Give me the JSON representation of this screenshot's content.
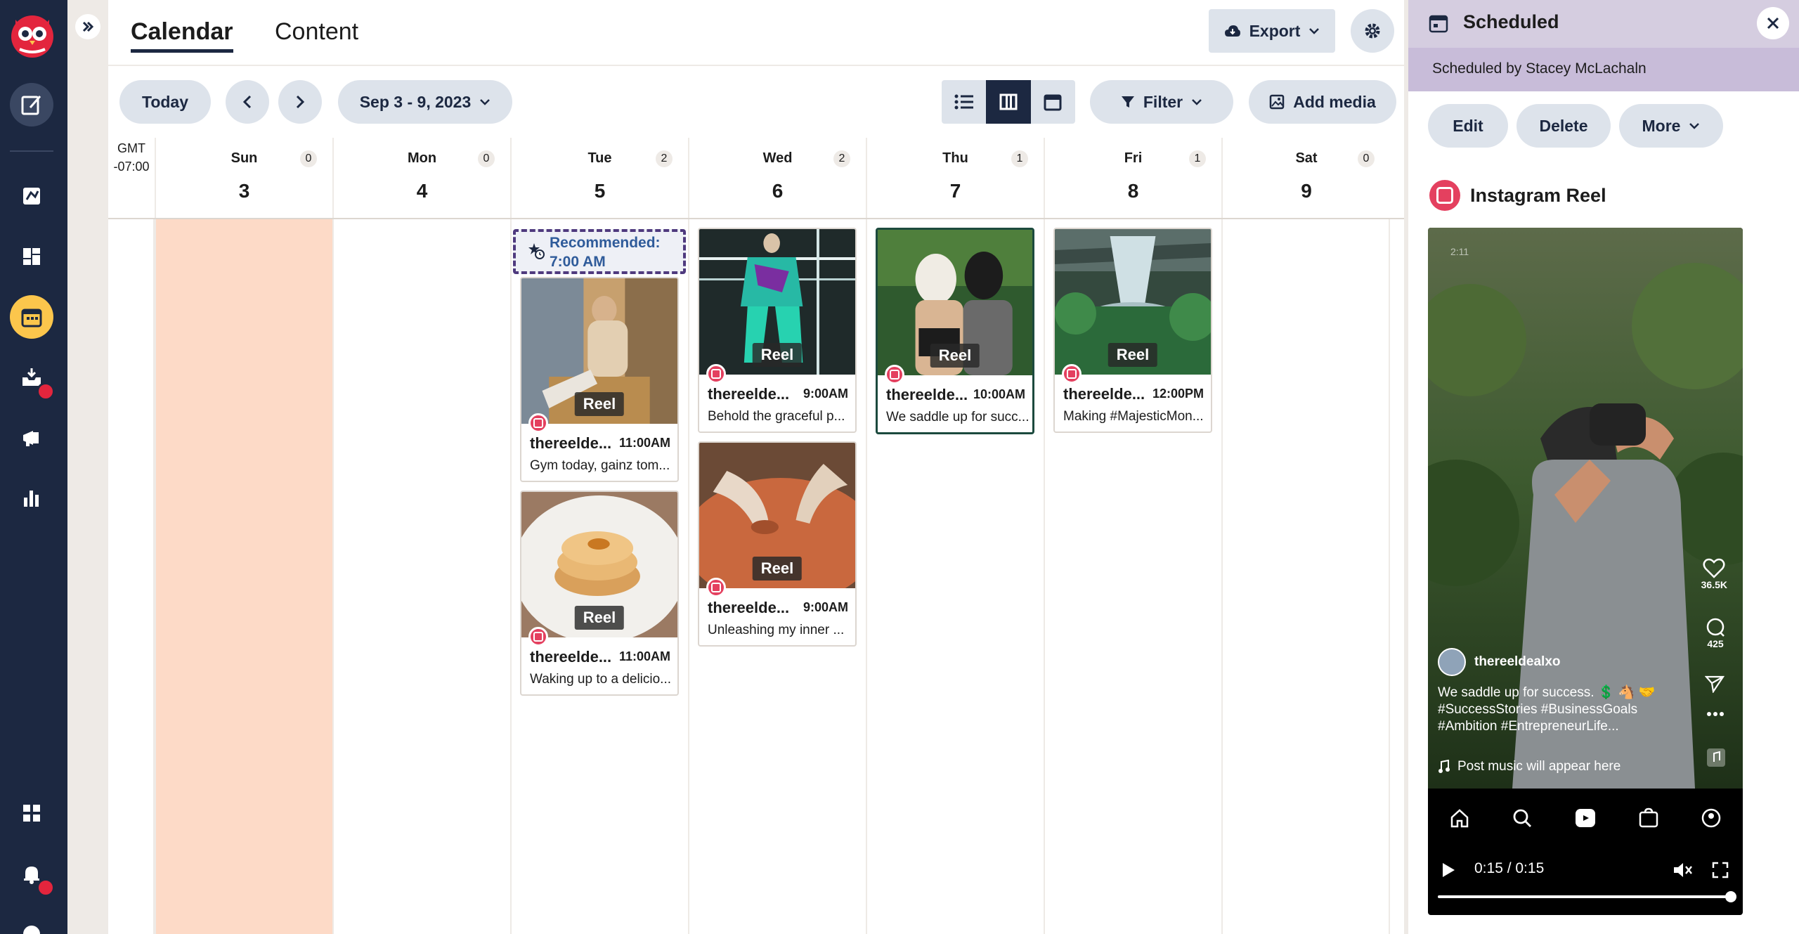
{
  "nav": {
    "logo_icon": "owl-logo-icon",
    "items": [
      {
        "name": "compose-icon"
      },
      {
        "name": "planner-icon"
      },
      {
        "name": "dashboard-icon"
      },
      {
        "name": "calendar-icon"
      },
      {
        "name": "inbox-icon"
      },
      {
        "name": "advertise-icon"
      },
      {
        "name": "analytics-icon"
      },
      {
        "name": "apps-icon"
      },
      {
        "name": "notifications-icon"
      },
      {
        "name": "help-icon"
      }
    ]
  },
  "header": {
    "tabs": [
      {
        "label": "Calendar",
        "active": true
      },
      {
        "label": "Content",
        "active": false
      }
    ],
    "export_label": "Export"
  },
  "toolbar": {
    "today_label": "Today",
    "date_range": "Sep 3 - 9, 2023",
    "filter_label": "Filter",
    "add_media_label": "Add media"
  },
  "calendar": {
    "timezone_line1": "GMT",
    "timezone_line2": "-07:00",
    "days": [
      {
        "name": "Sun",
        "num": "3",
        "count": "0"
      },
      {
        "name": "Mon",
        "num": "4",
        "count": "0"
      },
      {
        "name": "Tue",
        "num": "5",
        "count": "2"
      },
      {
        "name": "Wed",
        "num": "6",
        "count": "2"
      },
      {
        "name": "Thu",
        "num": "7",
        "count": "1"
      },
      {
        "name": "Fri",
        "num": "8",
        "count": "1"
      },
      {
        "name": "Sat",
        "num": "9",
        "count": "0"
      }
    ],
    "recommended": "Recommended: 7:00 AM",
    "reel_label": "Reel",
    "posts": [
      {
        "account": "thereelde...",
        "time": "11:00AM",
        "text": "Gym today, gainz tom..."
      },
      {
        "account": "thereelde...",
        "time": "11:00AM",
        "text": "Waking up to a delicio..."
      },
      {
        "account": "thereelde...",
        "time": "9:00AM",
        "text": "Behold the graceful p..."
      },
      {
        "account": "thereelde...",
        "time": "9:00AM",
        "text": "Unleashing my inner ..."
      },
      {
        "account": "thereelde...",
        "time": "10:00AM",
        "text": "We saddle up for succ..."
      },
      {
        "account": "thereelde...",
        "time": "12:00PM",
        "text": "Making #MajesticMon..."
      }
    ]
  },
  "panel": {
    "title": "Scheduled",
    "subtitle": "Scheduled by Stacey McLachaln",
    "edit_label": "Edit",
    "delete_label": "Delete",
    "more_label": "More",
    "post_type": "Instagram Reel",
    "preview": {
      "status_time": "2:11",
      "likes": "36.5K",
      "comments": "425",
      "username": "thereeldealxo",
      "caption": "We saddle up for success. 💲 🐴 🤝 #SuccessStories #BusinessGoals #Ambition #EntrepreneurLife...",
      "music": "Post music will appear here",
      "time": "0:15 / 0:15"
    }
  },
  "colors": {
    "nav_bg": "#1c2841",
    "active_nav": "#fcc64c",
    "today_col": "#fddac7",
    "panel_header": "#d5cde0",
    "instagram": "#e4405f"
  }
}
